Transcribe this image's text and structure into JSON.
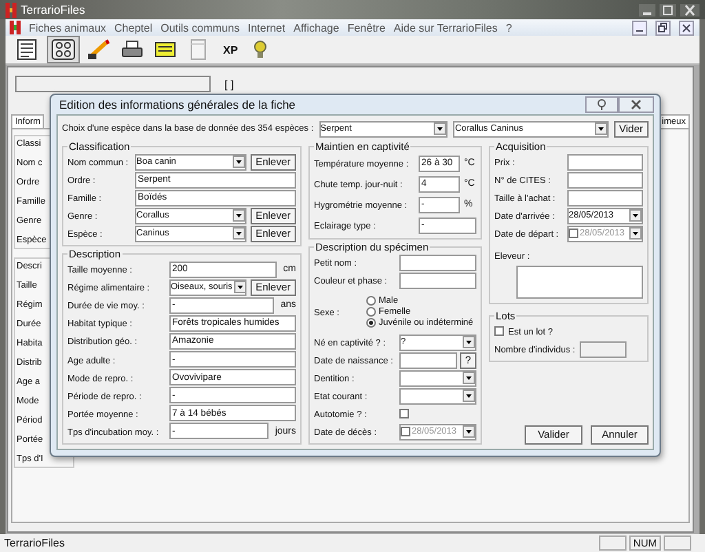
{
  "app": {
    "title": "TerrarioFiles"
  },
  "menu": [
    "Fiches animaux",
    "Cheptel",
    "Outils communs",
    "Internet",
    "Affichage",
    "Fenêtre",
    "Aide sur TerrarioFiles",
    "?"
  ],
  "toolbar": [
    {
      "kind": "sheet"
    },
    {
      "kind": "grid",
      "selected": true
    },
    {
      "kind": "pen"
    },
    {
      "kind": "printer"
    },
    {
      "kind": "note"
    },
    {
      "kind": "doc"
    },
    {
      "kind": "text",
      "label": "XP"
    },
    {
      "kind": "bulb"
    }
  ],
  "child": {
    "bracket": "[ ]",
    "tab_left": "Inform",
    "tab_right": "imeux",
    "groups": [
      {
        "title": "Classi",
        "labels": [
          "Nom c",
          "Ordre",
          "Famille",
          "Genre",
          "Espèce"
        ]
      },
      {
        "title": "Descri",
        "labels": [
          "Taille",
          "Régim",
          "Durée",
          "Habita",
          "Distrib",
          "Age a",
          "Mode",
          "Périod",
          "Portée",
          "Tps d'I"
        ]
      }
    ]
  },
  "dialog": {
    "title": "Edition des informations générales de la fiche",
    "prompt": "Choix d'une espèce dans la base de donnée des 354 espèces :",
    "group_select": "Serpent",
    "species_select": "Corallus Caninus",
    "clear_button": "Vider",
    "classification": {
      "title": "Classification",
      "rows": [
        {
          "label": "Nom commun :",
          "value": "Boa canin",
          "kind": "select",
          "button": "Enlever"
        },
        {
          "label": "Ordre :",
          "value": "Serpent",
          "kind": "text"
        },
        {
          "label": "Famille :",
          "value": "Boïdés",
          "kind": "text"
        },
        {
          "label": "Genre :",
          "value": "Corallus",
          "kind": "select",
          "button": "Enlever"
        },
        {
          "label": "Espèce :",
          "value": "Caninus",
          "kind": "select",
          "button": "Enlever"
        }
      ]
    },
    "description": {
      "title": "Description",
      "rows": [
        {
          "label": "Taille moyenne :",
          "value": "200",
          "kind": "text",
          "unit": "cm"
        },
        {
          "label": "Régime alimentaire :",
          "value": "Oiseaux, souris",
          "kind": "select",
          "button": "Enlever"
        },
        {
          "label": "Durée de vie moy. :",
          "value": "-",
          "kind": "text",
          "unit": "ans"
        },
        {
          "label": "Habitat typique :",
          "value": "Forêts tropicales humides",
          "kind": "text"
        },
        {
          "label": "Distribution géo. :",
          "value": "Amazonie",
          "kind": "text"
        },
        {
          "label": "Age adulte :",
          "value": "-",
          "kind": "text"
        },
        {
          "label": "Mode de repro. :",
          "value": "Ovovivipare",
          "kind": "text"
        },
        {
          "label": "Période de repro. :",
          "value": "-",
          "kind": "text"
        },
        {
          "label": "Portée moyenne :",
          "value": "7 à 14 bébés",
          "kind": "text"
        },
        {
          "label": "Tps d'incubation moy. :",
          "value": "-",
          "kind": "text",
          "unit": "jours"
        }
      ]
    },
    "captivity": {
      "title": "Maintien en captivité",
      "rows": [
        {
          "label": "Température moyenne :",
          "value": "26 à 30",
          "unit": "°C"
        },
        {
          "label": "Chute temp. jour-nuit :",
          "value": "4",
          "unit": "°C"
        },
        {
          "label": "Hygrométrie moyenne :",
          "value": "-",
          "unit": "%"
        },
        {
          "label": "Eclairage type :",
          "value": "-"
        }
      ]
    },
    "specimen": {
      "title": "Description du spécimen",
      "rows": [
        {
          "label": "Petit nom :",
          "kind": "text"
        },
        {
          "label": "Couleur et phase :",
          "kind": "text"
        },
        {
          "label": "Sexe :",
          "kind": "radio",
          "options": [
            {
              "label": "Male",
              "selected": false
            },
            {
              "label": "Femelle",
              "selected": false
            },
            {
              "label": "Juvénile ou indéterminé",
              "selected": true
            }
          ]
        },
        {
          "label": "Né en captivité ? :",
          "kind": "select",
          "value": "?"
        },
        {
          "label": "Date de naissance :",
          "kind": "button_field",
          "button": "?"
        },
        {
          "label": "Dentition :",
          "kind": "select"
        },
        {
          "label": "Etat courant :",
          "kind": "select"
        },
        {
          "label": "Autotomie ? :",
          "kind": "checkbox",
          "checked": false
        },
        {
          "label": "Date de décès :",
          "kind": "date",
          "value": "28/05/2013",
          "checked": false
        }
      ]
    },
    "acquisition": {
      "title": "Acquisition",
      "rows": [
        {
          "label": "Prix :",
          "kind": "text"
        },
        {
          "label": "N° de CITES :",
          "kind": "text"
        },
        {
          "label": "Taille à l'achat :",
          "kind": "text"
        },
        {
          "label": "Date d'arrivée :",
          "kind": "date",
          "value": "28/05/2013"
        },
        {
          "label": "Date de départ :",
          "kind": "date",
          "value": "28/05/2013",
          "checked": false
        },
        {
          "label": "Eleveur :",
          "kind": "area"
        }
      ]
    },
    "lots": {
      "title": "Lots",
      "checkbox": {
        "label": "Est un lot ?",
        "checked": false
      },
      "count_label": "Nombre d'individus :"
    },
    "buttons": [
      "Valider",
      "Annuler"
    ]
  },
  "status_bar": {
    "text": "TerrarioFiles",
    "indicator": "NUM"
  }
}
